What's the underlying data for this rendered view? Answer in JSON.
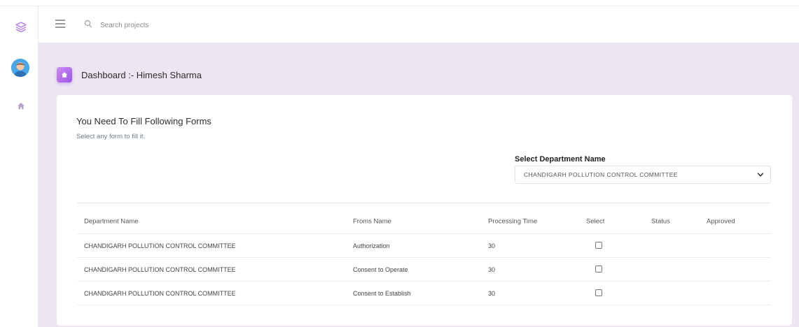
{
  "header": {
    "search": {
      "placeholder": "Search projects",
      "value": ""
    }
  },
  "sidebar": {
    "icons": [
      "layers-logo-icon",
      "user-avatar",
      "home-icon"
    ]
  },
  "page": {
    "title": "Dashboard :- Himesh Sharma"
  },
  "card": {
    "title": "You Need To Fill Following Forms",
    "subtitle": "Select any form to fill it.",
    "department_label": "Select Department Name",
    "department_selected": "CHANDIGARH POLLUTION CONTROL COMMITTEE"
  },
  "table": {
    "headers": [
      "Department Name",
      "Froms Name",
      "Processing Time",
      "Select",
      "Status",
      "Approved"
    ],
    "rows": [
      {
        "department": "CHANDIGARH POLLUTION CONTROL COMMITTEE",
        "form": "Authorization",
        "time": "30",
        "status": "",
        "approved": ""
      },
      {
        "department": "CHANDIGARH POLLUTION CONTROL COMMITTEE",
        "form": "Consent to Operate",
        "time": "30",
        "status": "",
        "approved": ""
      },
      {
        "department": "CHANDIGARH POLLUTION CONTROL COMMITTEE",
        "form": "Consent to Establish",
        "time": "30",
        "status": "",
        "approved": ""
      }
    ]
  },
  "colors": {
    "accent": "#a865ee",
    "content_bg": "#ede6f2",
    "card_bg": "#ffffff"
  }
}
